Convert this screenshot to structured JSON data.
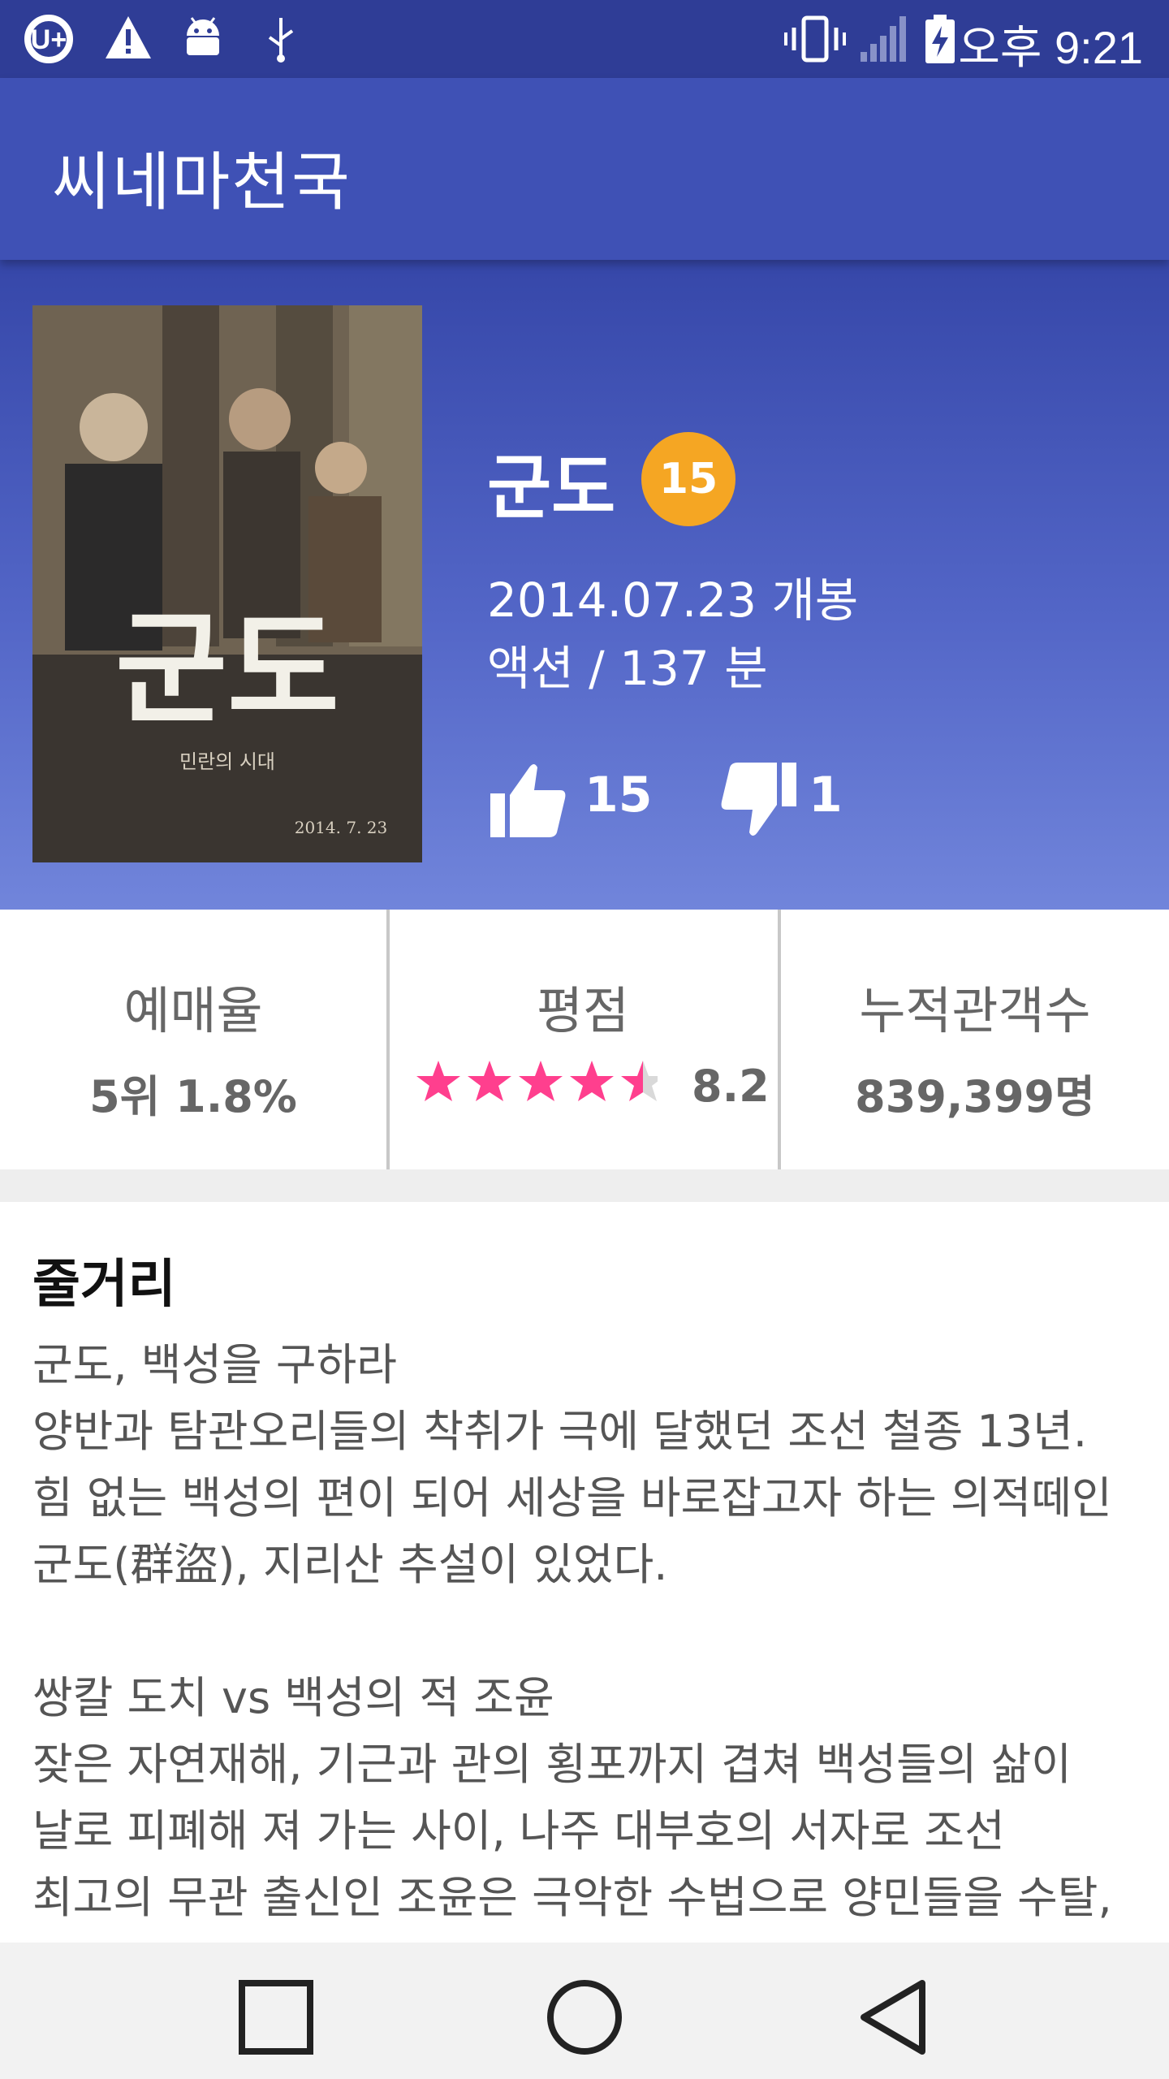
{
  "status_bar": {
    "time": "오후 9:21",
    "icons": [
      "carrier-logo-icon",
      "warning-icon",
      "android-debug-icon",
      "usb-icon",
      "vibrate-icon",
      "signal-icon",
      "battery-charging-icon"
    ]
  },
  "app_bar": {
    "title": "씨네마천국"
  },
  "movie": {
    "title": "군도",
    "grade": "15",
    "release": "2014.07.23 개봉",
    "genre_runtime": "액션 / 137 분",
    "likes": "15",
    "dislikes": "1",
    "grade_color": "#f5a623"
  },
  "poster": {
    "title_text": "군도",
    "subtitle_text": "민란의 시대",
    "date_text": "2014. 7. 23"
  },
  "stats": {
    "reservation": {
      "label": "예매율",
      "value": "5위  1.8%"
    },
    "rating": {
      "label": "평점",
      "value": "8.2",
      "stars": 4.5,
      "star_color": "#ff3f8e"
    },
    "audience": {
      "label": "누적관객수",
      "value": "839,399명"
    }
  },
  "synopsis": {
    "heading": "줄거리",
    "lines": [
      "군도, 백성을 구하라",
      "양반과 탐관오리들의 착취가 극에 달했던 조선 철종 13년.",
      "힘 없는 백성의 편이 되어 세상을 바로잡고자 하는 의적떼인",
      "군도(群盜), 지리산 추설이 있었다.",
      "",
      "쌍칼 도치 vs 백성의 적 조윤",
      "잦은 자연재해, 기근과 관의 횡포까지 겹쳐 백성들의 삶이",
      "날로 피폐해 져 가는 사이, 나주 대부호의 서자로 조선",
      "최고의 무관 출신인 조윤은 극악한 수법으로 양민들을 수탈,"
    ]
  },
  "colors": {
    "primary": "#3f51b5",
    "primary_dark": "#2f3d96"
  }
}
